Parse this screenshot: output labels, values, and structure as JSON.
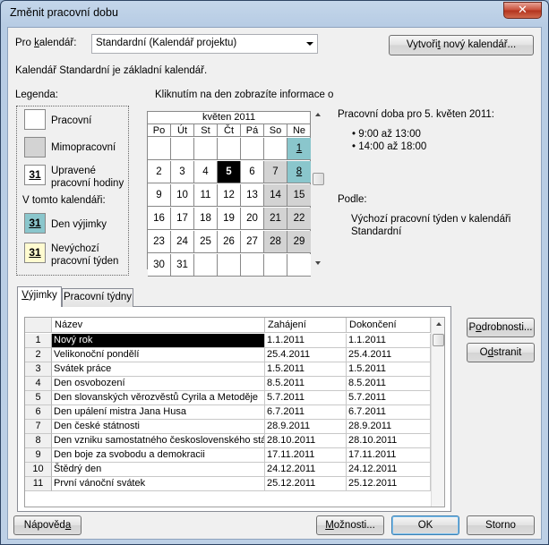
{
  "window": {
    "title": "Změnit pracovní dobu",
    "close_glyph": "✕"
  },
  "calendar_select": {
    "label_prefix": "Pro ",
    "label_accel": "k",
    "label_suffix": "alendář:",
    "value": "Standardní (Kalendář projektu)"
  },
  "new_calendar_button": {
    "prefix": "Vytvoři",
    "accel": "t",
    "suffix": " nový kalendář..."
  },
  "base_calendar_text": "Kalendář Standardní je základní kalendář.",
  "legend": {
    "title": "Legenda:",
    "working": "Pracovní",
    "nonworking": "Mimopracovní",
    "edited_line1": "Upravené",
    "edited_line2": "pracovní hodiny",
    "in_calendar": "V tomto kalendáři:",
    "exception_day": "Den výjimky",
    "nondefault_line1": "Nevýchozí",
    "nondefault_line2": "pracovní týden",
    "sample_day": "31"
  },
  "calendar": {
    "hint": "Kliknutím na den zobrazíte informace o",
    "month": "květen 2011",
    "weekdays": [
      "Po",
      "Út",
      "St",
      "Čt",
      "Pá",
      "So",
      "Ne"
    ],
    "weeks": [
      [
        "",
        "",
        "",
        "",
        "",
        "",
        "1"
      ],
      [
        "2",
        "3",
        "4",
        "5",
        "6",
        "7",
        "8"
      ],
      [
        "9",
        "10",
        "11",
        "12",
        "13",
        "14",
        "15"
      ],
      [
        "16",
        "17",
        "18",
        "19",
        "20",
        "21",
        "22"
      ],
      [
        "23",
        "24",
        "25",
        "26",
        "27",
        "28",
        "29"
      ],
      [
        "30",
        "31",
        "",
        "",
        "",
        "",
        ""
      ]
    ],
    "selected_day": "5",
    "exception_days": [
      "1",
      "8"
    ]
  },
  "working_time": {
    "heading": "Pracovní doba pro 5. květen 2011:",
    "slots": [
      "9:00 až 13:00",
      "14:00 až 18:00"
    ],
    "based_on_label": "Podle:",
    "based_on_line1": "Výchozí pracovní týden v kalendáři",
    "based_on_line2": "Standardní"
  },
  "tabs": [
    {
      "label": "Výjimky",
      "accel": "V"
    },
    {
      "label": "Pracovní týdny"
    }
  ],
  "exceptions_table": {
    "columns": [
      "Název",
      "Zahájení",
      "Dokončení"
    ],
    "rows": [
      {
        "num": "1",
        "name": "Nový rok",
        "start": "1.1.2011",
        "end": "1.1.2011"
      },
      {
        "num": "2",
        "name": "Velikonoční pondělí",
        "start": "25.4.2011",
        "end": "25.4.2011"
      },
      {
        "num": "3",
        "name": "Svátek práce",
        "start": "1.5.2011",
        "end": "1.5.2011"
      },
      {
        "num": "4",
        "name": "Den osvobození",
        "start": "8.5.2011",
        "end": "8.5.2011"
      },
      {
        "num": "5",
        "name": "Den slovanských věrozvěstů Cyrila a Metoděje",
        "start": "5.7.2011",
        "end": "5.7.2011"
      },
      {
        "num": "6",
        "name": "Den upálení mistra Jana Husa",
        "start": "6.7.2011",
        "end": "6.7.2011"
      },
      {
        "num": "7",
        "name": "Den české státnosti",
        "start": "28.9.2011",
        "end": "28.9.2011"
      },
      {
        "num": "8",
        "name": "Den vzniku samostatného československého stát",
        "start": "28.10.2011",
        "end": "28.10.2011"
      },
      {
        "num": "9",
        "name": "Den boje za svobodu a demokracii",
        "start": "17.11.2011",
        "end": "17.11.2011"
      },
      {
        "num": "10",
        "name": "Štědrý den",
        "start": "24.12.2011",
        "end": "24.12.2011"
      },
      {
        "num": "11",
        "name": "První vánoční svátek",
        "start": "25.12.2011",
        "end": "25.12.2011"
      }
    ]
  },
  "buttons": {
    "details": {
      "prefix": "P",
      "accel": "o",
      "suffix": "drobnosti..."
    },
    "delete": {
      "prefix": "O",
      "accel": "d",
      "suffix": "stranit"
    },
    "help": {
      "prefix": "Nápověd",
      "accel": "a",
      "suffix": ""
    },
    "options": {
      "prefix": "",
      "accel": "M",
      "suffix": "ožnosti..."
    },
    "ok": "OK",
    "cancel": "Storno"
  }
}
